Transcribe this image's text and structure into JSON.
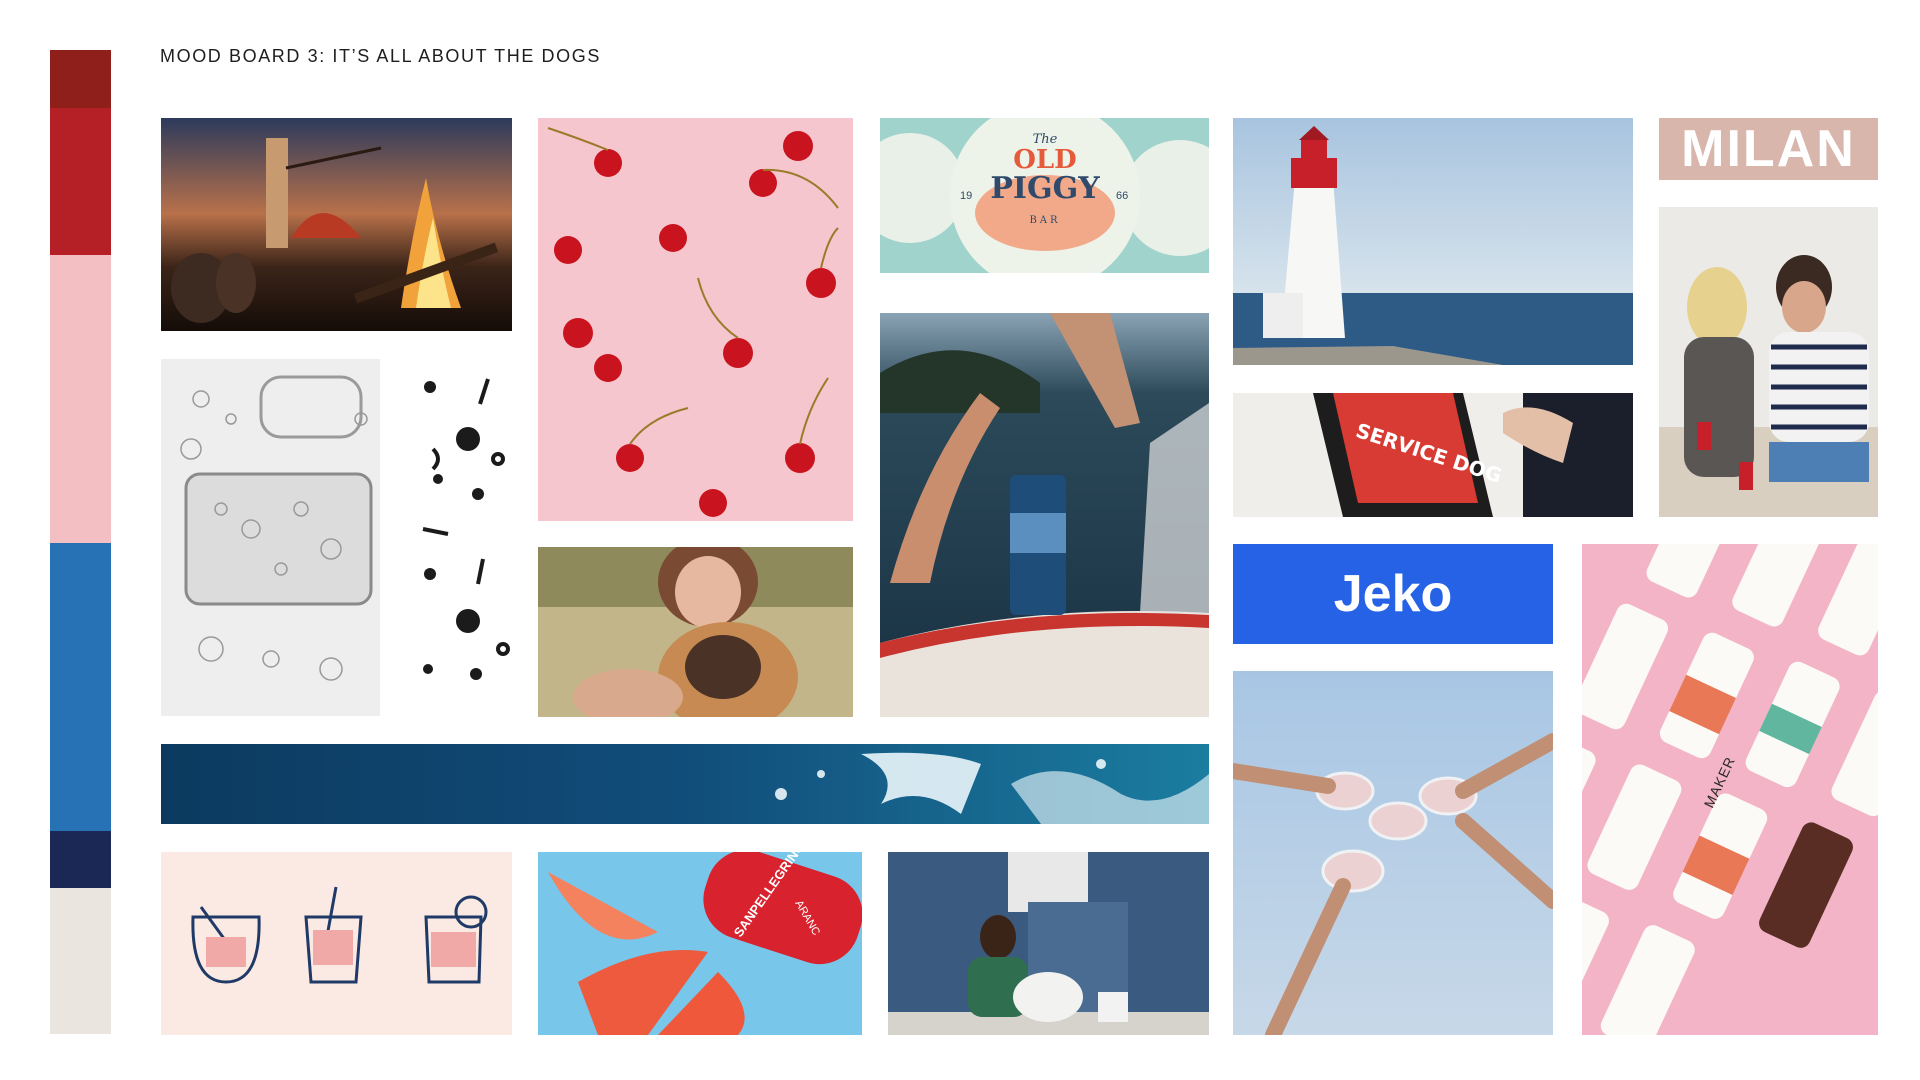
{
  "page": {
    "title": "MOOD BOARD 3: IT’S ALL ABOUT THE DOGS"
  },
  "palette": {
    "swatches": [
      "#8e1f1b",
      "#b51f26",
      "#f3bfc2",
      "#2772b4",
      "#1b2856",
      "#ebe5df"
    ]
  },
  "tiles": {
    "campfire": {
      "icon": "campfire-photo"
    },
    "bubbles": {
      "icon": "bubbles-photo"
    },
    "paw_pattern": {
      "icon": "paw-bone-pattern"
    },
    "cherries": {
      "icon": "cherry-pattern"
    },
    "coasters": {
      "brand_line1": "The",
      "brand_line2": "OLD",
      "brand_line3": "PIGGY",
      "brand_line4": "BAR",
      "left_num": "19",
      "right_num": "66"
    },
    "lighthouse": {
      "icon": "lighthouse-photo"
    },
    "milan": {
      "text": "MILAN"
    },
    "couple": {
      "icon": "couple-photo"
    },
    "service_dog": {
      "badge": "SERVICE DOG"
    },
    "jeko": {
      "text": "Jeko"
    },
    "girl_dog": {
      "icon": "pug-photo"
    },
    "boat_can": {
      "icon": "boat-can-photo"
    },
    "toast": {
      "icon": "toast-photo"
    },
    "maker_cans": {
      "label": "MAKER"
    },
    "ocean": {
      "icon": "ocean-water"
    },
    "cocktails": {
      "icon": "cocktail-icons"
    },
    "grapefruit": {
      "can_label": "SANPELLEGRINO",
      "flavor": "ARANC"
    },
    "kitchen": {
      "icon": "kitchen-photo"
    }
  }
}
